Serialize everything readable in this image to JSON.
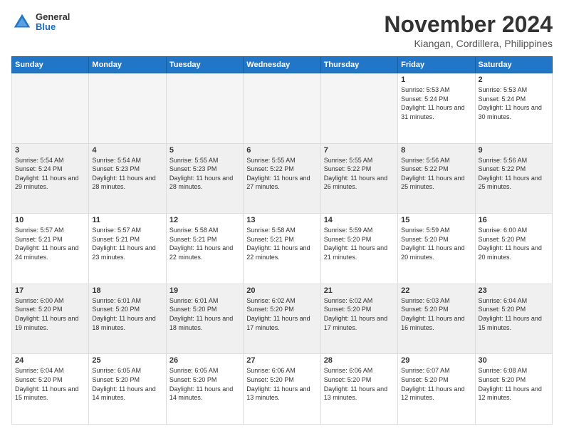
{
  "header": {
    "logo_general": "General",
    "logo_blue": "Blue",
    "month_title": "November 2024",
    "location": "Kiangan, Cordillera, Philippines"
  },
  "days_of_week": [
    "Sunday",
    "Monday",
    "Tuesday",
    "Wednesday",
    "Thursday",
    "Friday",
    "Saturday"
  ],
  "weeks": [
    [
      {
        "day": "",
        "info": ""
      },
      {
        "day": "",
        "info": ""
      },
      {
        "day": "",
        "info": ""
      },
      {
        "day": "",
        "info": ""
      },
      {
        "day": "",
        "info": ""
      },
      {
        "day": "1",
        "info": "Sunrise: 5:53 AM\nSunset: 5:24 PM\nDaylight: 11 hours and 31 minutes."
      },
      {
        "day": "2",
        "info": "Sunrise: 5:53 AM\nSunset: 5:24 PM\nDaylight: 11 hours and 30 minutes."
      }
    ],
    [
      {
        "day": "3",
        "info": "Sunrise: 5:54 AM\nSunset: 5:24 PM\nDaylight: 11 hours and 29 minutes."
      },
      {
        "day": "4",
        "info": "Sunrise: 5:54 AM\nSunset: 5:23 PM\nDaylight: 11 hours and 28 minutes."
      },
      {
        "day": "5",
        "info": "Sunrise: 5:55 AM\nSunset: 5:23 PM\nDaylight: 11 hours and 28 minutes."
      },
      {
        "day": "6",
        "info": "Sunrise: 5:55 AM\nSunset: 5:22 PM\nDaylight: 11 hours and 27 minutes."
      },
      {
        "day": "7",
        "info": "Sunrise: 5:55 AM\nSunset: 5:22 PM\nDaylight: 11 hours and 26 minutes."
      },
      {
        "day": "8",
        "info": "Sunrise: 5:56 AM\nSunset: 5:22 PM\nDaylight: 11 hours and 25 minutes."
      },
      {
        "day": "9",
        "info": "Sunrise: 5:56 AM\nSunset: 5:22 PM\nDaylight: 11 hours and 25 minutes."
      }
    ],
    [
      {
        "day": "10",
        "info": "Sunrise: 5:57 AM\nSunset: 5:21 PM\nDaylight: 11 hours and 24 minutes."
      },
      {
        "day": "11",
        "info": "Sunrise: 5:57 AM\nSunset: 5:21 PM\nDaylight: 11 hours and 23 minutes."
      },
      {
        "day": "12",
        "info": "Sunrise: 5:58 AM\nSunset: 5:21 PM\nDaylight: 11 hours and 22 minutes."
      },
      {
        "day": "13",
        "info": "Sunrise: 5:58 AM\nSunset: 5:21 PM\nDaylight: 11 hours and 22 minutes."
      },
      {
        "day": "14",
        "info": "Sunrise: 5:59 AM\nSunset: 5:20 PM\nDaylight: 11 hours and 21 minutes."
      },
      {
        "day": "15",
        "info": "Sunrise: 5:59 AM\nSunset: 5:20 PM\nDaylight: 11 hours and 20 minutes."
      },
      {
        "day": "16",
        "info": "Sunrise: 6:00 AM\nSunset: 5:20 PM\nDaylight: 11 hours and 20 minutes."
      }
    ],
    [
      {
        "day": "17",
        "info": "Sunrise: 6:00 AM\nSunset: 5:20 PM\nDaylight: 11 hours and 19 minutes."
      },
      {
        "day": "18",
        "info": "Sunrise: 6:01 AM\nSunset: 5:20 PM\nDaylight: 11 hours and 18 minutes."
      },
      {
        "day": "19",
        "info": "Sunrise: 6:01 AM\nSunset: 5:20 PM\nDaylight: 11 hours and 18 minutes."
      },
      {
        "day": "20",
        "info": "Sunrise: 6:02 AM\nSunset: 5:20 PM\nDaylight: 11 hours and 17 minutes."
      },
      {
        "day": "21",
        "info": "Sunrise: 6:02 AM\nSunset: 5:20 PM\nDaylight: 11 hours and 17 minutes."
      },
      {
        "day": "22",
        "info": "Sunrise: 6:03 AM\nSunset: 5:20 PM\nDaylight: 11 hours and 16 minutes."
      },
      {
        "day": "23",
        "info": "Sunrise: 6:04 AM\nSunset: 5:20 PM\nDaylight: 11 hours and 15 minutes."
      }
    ],
    [
      {
        "day": "24",
        "info": "Sunrise: 6:04 AM\nSunset: 5:20 PM\nDaylight: 11 hours and 15 minutes."
      },
      {
        "day": "25",
        "info": "Sunrise: 6:05 AM\nSunset: 5:20 PM\nDaylight: 11 hours and 14 minutes."
      },
      {
        "day": "26",
        "info": "Sunrise: 6:05 AM\nSunset: 5:20 PM\nDaylight: 11 hours and 14 minutes."
      },
      {
        "day": "27",
        "info": "Sunrise: 6:06 AM\nSunset: 5:20 PM\nDaylight: 11 hours and 13 minutes."
      },
      {
        "day": "28",
        "info": "Sunrise: 6:06 AM\nSunset: 5:20 PM\nDaylight: 11 hours and 13 minutes."
      },
      {
        "day": "29",
        "info": "Sunrise: 6:07 AM\nSunset: 5:20 PM\nDaylight: 11 hours and 12 minutes."
      },
      {
        "day": "30",
        "info": "Sunrise: 6:08 AM\nSunset: 5:20 PM\nDaylight: 11 hours and 12 minutes."
      }
    ]
  ]
}
